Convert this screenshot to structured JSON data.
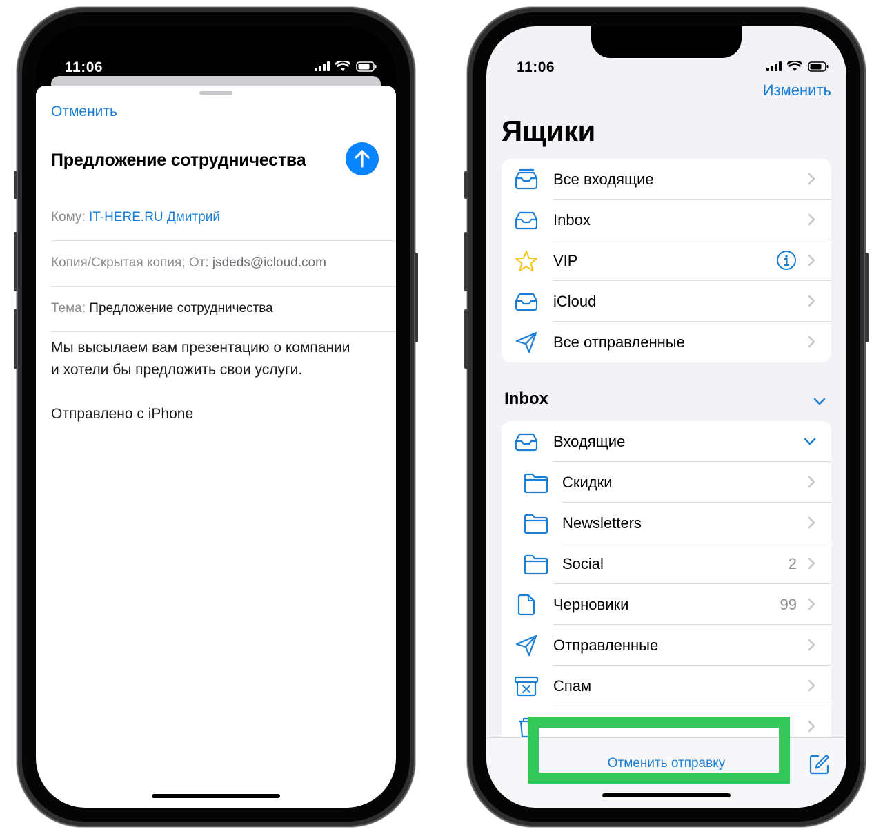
{
  "left_phone": {
    "status_time": "11:06",
    "cancel_label": "Отменить",
    "subject_title": "Предложение сотрудничества",
    "to_label": "Кому:",
    "to_value": "IT-HERE.RU Дмитрий",
    "cc_label": "Копия/Скрытая копия; От:",
    "cc_value": "jsdeds@icloud.com",
    "subject_label": "Тема:",
    "subject_value": "Предложение сотрудничества",
    "body_line1": "Мы высылаем вам презентацию о компании",
    "body_line2": "и хотели бы предложить свои услуги.",
    "signature": "Отправлено с iPhone"
  },
  "right_phone": {
    "status_time": "11:06",
    "edit_label": "Изменить",
    "title": "Ящики",
    "mailboxes": [
      {
        "label": "Все входящие",
        "icon": "tray-stack-icon"
      },
      {
        "label": "Inbox",
        "icon": "tray-icon"
      },
      {
        "label": "VIP",
        "icon": "star-icon"
      },
      {
        "label": "iCloud",
        "icon": "tray-icon"
      },
      {
        "label": "Все отправленные",
        "icon": "paperplane-icon"
      }
    ],
    "section_title": "Inbox",
    "inbox_rows": [
      {
        "label": "Входящие",
        "icon": "tray-icon",
        "count": ""
      },
      {
        "label": "Скидки",
        "icon": "folder-icon",
        "count": ""
      },
      {
        "label": "Newsletters",
        "icon": "folder-icon",
        "count": ""
      },
      {
        "label": "Social",
        "icon": "folder-icon",
        "count": "2"
      },
      {
        "label": "Черновики",
        "icon": "doc-icon",
        "count": "99"
      },
      {
        "label": "Отправленные",
        "icon": "paperplane-icon",
        "count": ""
      },
      {
        "label": "Спам",
        "icon": "junk-box-icon",
        "count": ""
      }
    ],
    "undo_send_label": "Отменить отправку"
  },
  "colors": {
    "accent_blue": "#1a7fd6",
    "send_button": "#0a84ff",
    "highlight_green": "#34c759",
    "vip_star": "#f5c518"
  }
}
